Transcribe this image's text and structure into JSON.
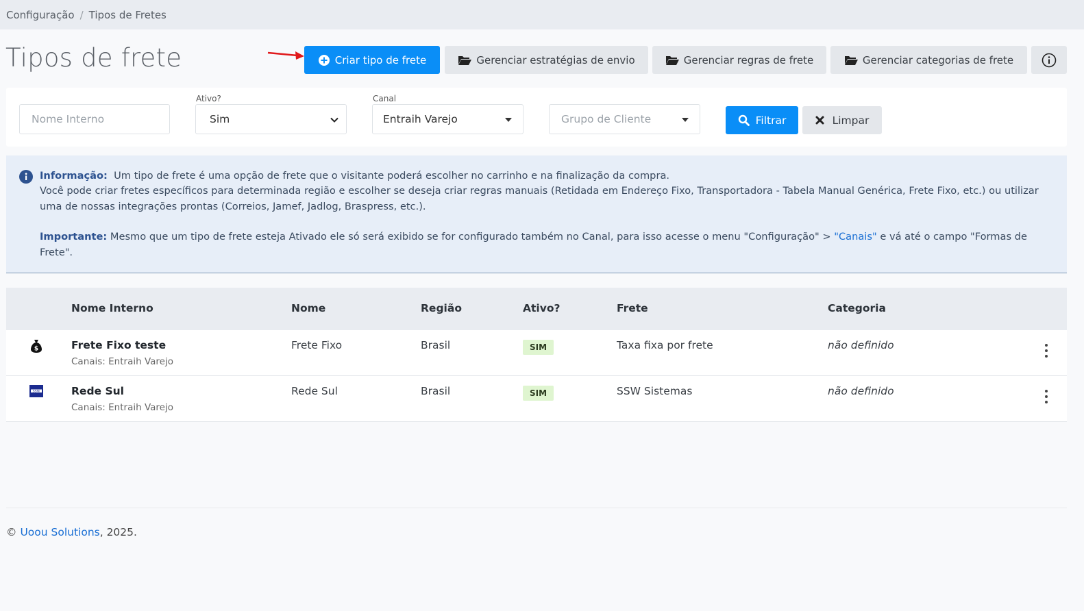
{
  "breadcrumb": {
    "parent": "Configuração",
    "current": "Tipos de Fretes"
  },
  "page_title": "Tipos de frete",
  "toolbar": {
    "create_label": "Criar tipo de frete",
    "strategies_label": "Gerenciar estratégias de envio",
    "rules_label": "Gerenciar regras de frete",
    "categories_label": "Gerenciar categorias de frete"
  },
  "filters": {
    "name_placeholder": "Nome Interno",
    "active_label": "Ativo?",
    "active_value": "Sim",
    "channel_label": "Canal",
    "channel_value": "Entraih Varejo",
    "group_placeholder": "Grupo de Cliente",
    "filter_label": "Filtrar",
    "clear_label": "Limpar"
  },
  "info": {
    "title": "Informação:",
    "line1": "Um tipo de frete é uma opção de frete que o visitante poderá escolher no carrinho e na finalização da compra.",
    "line2": "Você pode criar fretes específicos para determinada região e escolher se deseja criar regras manuais (Retidada em Endereço Fixo, Transportadora - Tabela Manual Genérica, Frete Fixo, etc.) ou utilizar uma de nossas integrações prontas (Correios, Jamef, Jadlog, Braspress, etc.).",
    "important_title": "Importante:",
    "important_text_a": "Mesmo que um tipo de frete esteja Ativado ele só será exibido se for configurado também no Canal, para isso acesse o menu \"Configuração\" > ",
    "important_link": "\"Canais\"",
    "important_text_b": " e vá até o campo \"Formas de Frete\"."
  },
  "table": {
    "headers": [
      "Nome Interno",
      "Nome",
      "Região",
      "Ativo?",
      "Frete",
      "Categoria"
    ],
    "rows": [
      {
        "internal_name": "Frete Fixo teste",
        "channels": "Canais: Entraih Varejo",
        "name": "Frete Fixo",
        "region": "Brasil",
        "active": "SIM",
        "freight": "Taxa fixa por frete",
        "category": "não definido",
        "icon": "money-bag-icon"
      },
      {
        "internal_name": "Rede Sul",
        "channels": "Canais: Entraih Varejo",
        "name": "Rede Sul",
        "region": "Brasil",
        "active": "SIM",
        "freight": "SSW Sistemas",
        "category": "não definido",
        "icon": "ssw-logo",
        "logo_text": "SSW"
      }
    ]
  },
  "footer": {
    "prefix": "© ",
    "link": "Uoou Solutions",
    "suffix": ", 2025."
  },
  "colors": {
    "primary": "#0a8ef7",
    "badge_bg": "#dff5d0",
    "info_bg": "#e7eef8",
    "link": "#1a6fd4"
  }
}
